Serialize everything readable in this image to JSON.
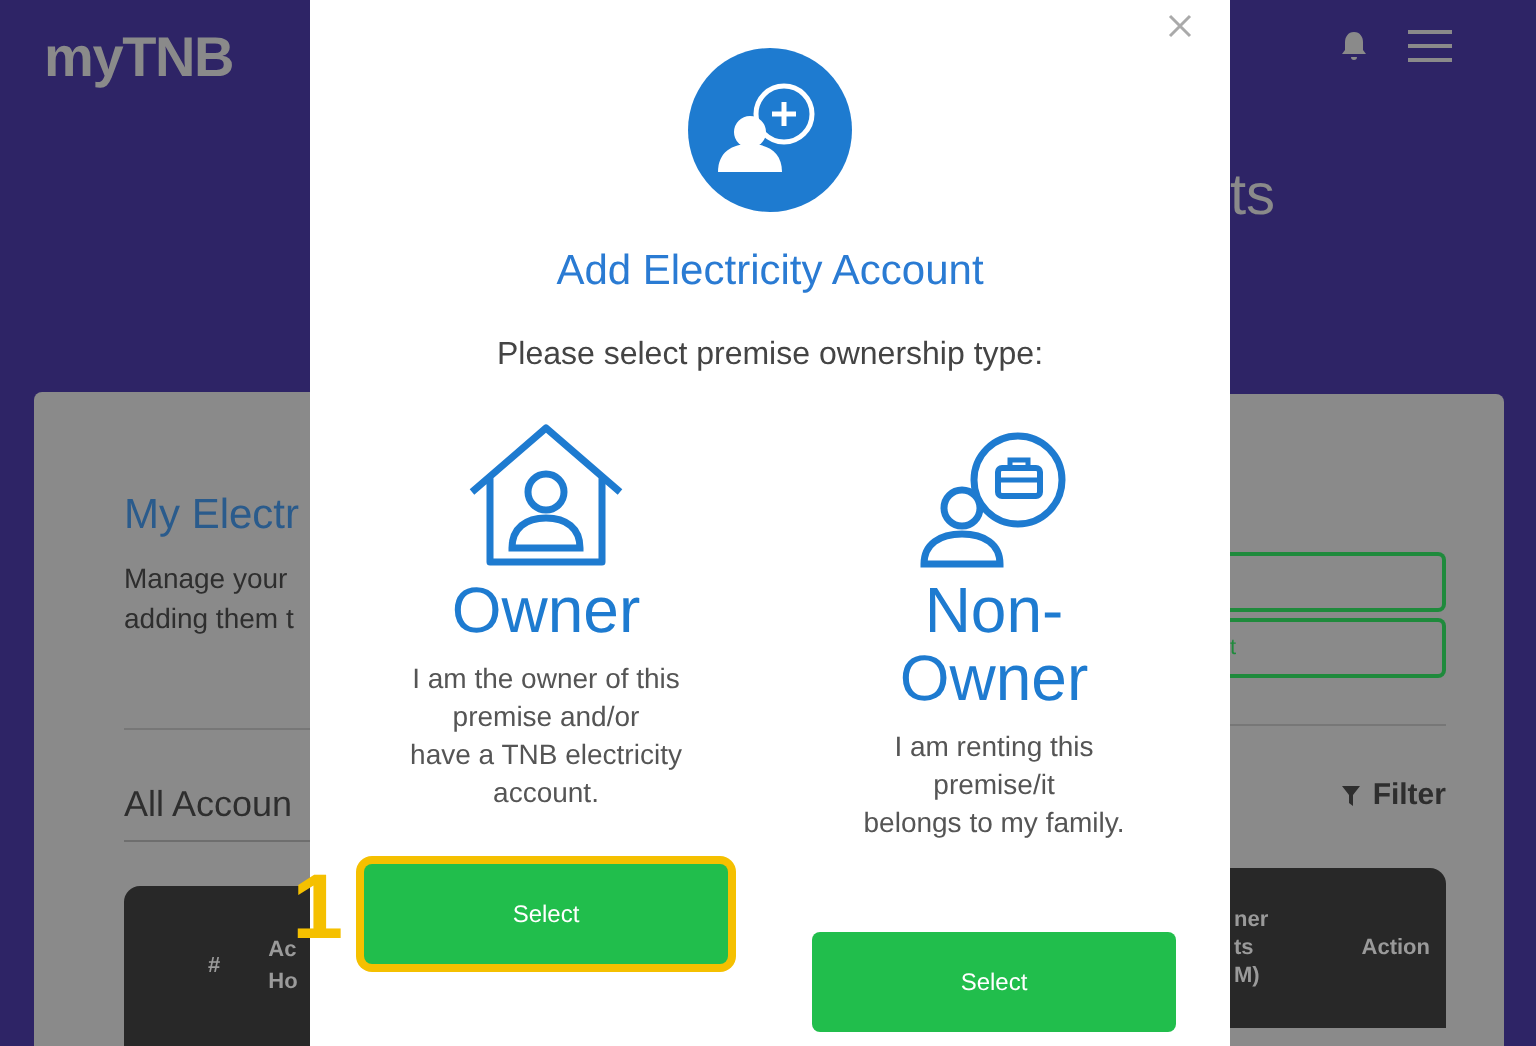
{
  "header": {
    "logo": "myTNB"
  },
  "page_title_fragment": "ts",
  "card": {
    "title": "My Electr",
    "description_lines": [
      "Manage your",
      "adding them t"
    ],
    "side_button": {
      "label": "t"
    },
    "dropdown": {
      "value": "All Accoun"
    },
    "filter": {
      "label": "Filter"
    },
    "table": {
      "left_columns": [
        "#",
        "Ac\nHo"
      ],
      "right_columns": [
        "ner\nts\nM)",
        "Action"
      ]
    }
  },
  "modal": {
    "title": "Add Electricity Account",
    "prompt": "Please select premise ownership type:",
    "options": [
      {
        "kind": "owner",
        "label": "Owner",
        "description": "I am the owner of this\npremise and/or\nhave a TNB electricity\naccount.",
        "button": "Select",
        "highlighted": true,
        "step": "1"
      },
      {
        "kind": "non_owner",
        "label": "Non-Owner",
        "description": "I am renting this\npremise/it\nbelongs to my family.",
        "button": "Select",
        "highlighted": false
      }
    ]
  }
}
